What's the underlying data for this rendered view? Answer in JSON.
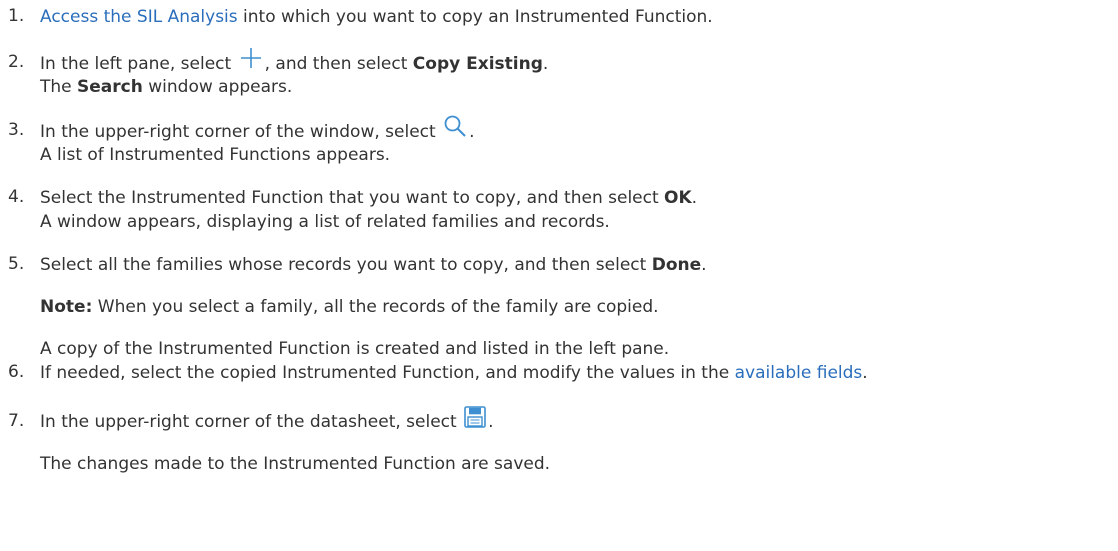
{
  "steps": [
    {
      "number": "1.",
      "link": "Access the SIL Analysis",
      "text_after_link": " into which you want to copy an Instrumented Function."
    },
    {
      "number": "2.",
      "text_before_icon": "In the left pane, select",
      "icon": "plus-icon",
      "text_after_icon": ", and then select ",
      "bold": "Copy Existing",
      "end": ".",
      "result_bold": "Search",
      "result_rest": " window appears.",
      "result_prefix": "The "
    },
    {
      "number": "3.",
      "text_before_icon": "In the upper-right corner of the window, select",
      "icon": "search-icon",
      "end": ".",
      "result": "A list of Instrumented Functions appears."
    },
    {
      "number": "4.",
      "text_before_bold": "Select the Instrumented Function that you want to copy, and then select ",
      "bold": "OK",
      "end": ".",
      "result": "A window appears, displaying a list of related families and records."
    },
    {
      "number": "5.",
      "text_before_bold": "Select all the families whose records you want to copy, and then select ",
      "bold": "Done",
      "end": ".",
      "note_label": "Note:",
      "note_text": " When you select a family, all the records of the family are copied.",
      "result": "A copy of the Instrumented Function is created and listed in the left pane."
    },
    {
      "number": "6.",
      "text_before_link": "If needed, select the copied Instrumented Function, and modify the values in the ",
      "link": "available fields",
      "end": "."
    },
    {
      "number": "7.",
      "text_before_icon": "In the upper-right corner of the datasheet, select",
      "icon": "save-icon",
      "end": ".",
      "result": "The changes made to the Instrumented Function are saved."
    }
  ],
  "colors": {
    "text": "#333333",
    "link": "#2a6ebb",
    "icon_blue": "#3d8fd1"
  }
}
